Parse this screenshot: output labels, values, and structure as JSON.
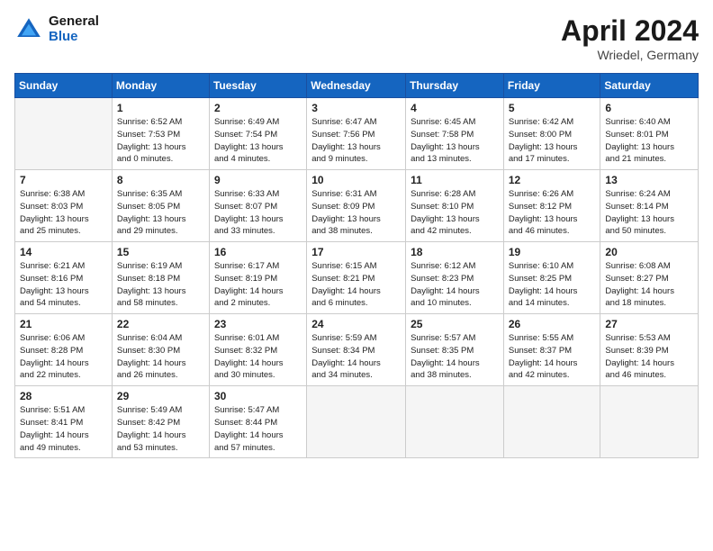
{
  "header": {
    "logo_general": "General",
    "logo_blue": "Blue",
    "title": "April 2024",
    "location": "Wriedel, Germany"
  },
  "days_of_week": [
    "Sunday",
    "Monday",
    "Tuesday",
    "Wednesday",
    "Thursday",
    "Friday",
    "Saturday"
  ],
  "weeks": [
    [
      {
        "day": "",
        "info": ""
      },
      {
        "day": "1",
        "info": "Sunrise: 6:52 AM\nSunset: 7:53 PM\nDaylight: 13 hours\nand 0 minutes."
      },
      {
        "day": "2",
        "info": "Sunrise: 6:49 AM\nSunset: 7:54 PM\nDaylight: 13 hours\nand 4 minutes."
      },
      {
        "day": "3",
        "info": "Sunrise: 6:47 AM\nSunset: 7:56 PM\nDaylight: 13 hours\nand 9 minutes."
      },
      {
        "day": "4",
        "info": "Sunrise: 6:45 AM\nSunset: 7:58 PM\nDaylight: 13 hours\nand 13 minutes."
      },
      {
        "day": "5",
        "info": "Sunrise: 6:42 AM\nSunset: 8:00 PM\nDaylight: 13 hours\nand 17 minutes."
      },
      {
        "day": "6",
        "info": "Sunrise: 6:40 AM\nSunset: 8:01 PM\nDaylight: 13 hours\nand 21 minutes."
      }
    ],
    [
      {
        "day": "7",
        "info": "Sunrise: 6:38 AM\nSunset: 8:03 PM\nDaylight: 13 hours\nand 25 minutes."
      },
      {
        "day": "8",
        "info": "Sunrise: 6:35 AM\nSunset: 8:05 PM\nDaylight: 13 hours\nand 29 minutes."
      },
      {
        "day": "9",
        "info": "Sunrise: 6:33 AM\nSunset: 8:07 PM\nDaylight: 13 hours\nand 33 minutes."
      },
      {
        "day": "10",
        "info": "Sunrise: 6:31 AM\nSunset: 8:09 PM\nDaylight: 13 hours\nand 38 minutes."
      },
      {
        "day": "11",
        "info": "Sunrise: 6:28 AM\nSunset: 8:10 PM\nDaylight: 13 hours\nand 42 minutes."
      },
      {
        "day": "12",
        "info": "Sunrise: 6:26 AM\nSunset: 8:12 PM\nDaylight: 13 hours\nand 46 minutes."
      },
      {
        "day": "13",
        "info": "Sunrise: 6:24 AM\nSunset: 8:14 PM\nDaylight: 13 hours\nand 50 minutes."
      }
    ],
    [
      {
        "day": "14",
        "info": "Sunrise: 6:21 AM\nSunset: 8:16 PM\nDaylight: 13 hours\nand 54 minutes."
      },
      {
        "day": "15",
        "info": "Sunrise: 6:19 AM\nSunset: 8:18 PM\nDaylight: 13 hours\nand 58 minutes."
      },
      {
        "day": "16",
        "info": "Sunrise: 6:17 AM\nSunset: 8:19 PM\nDaylight: 14 hours\nand 2 minutes."
      },
      {
        "day": "17",
        "info": "Sunrise: 6:15 AM\nSunset: 8:21 PM\nDaylight: 14 hours\nand 6 minutes."
      },
      {
        "day": "18",
        "info": "Sunrise: 6:12 AM\nSunset: 8:23 PM\nDaylight: 14 hours\nand 10 minutes."
      },
      {
        "day": "19",
        "info": "Sunrise: 6:10 AM\nSunset: 8:25 PM\nDaylight: 14 hours\nand 14 minutes."
      },
      {
        "day": "20",
        "info": "Sunrise: 6:08 AM\nSunset: 8:27 PM\nDaylight: 14 hours\nand 18 minutes."
      }
    ],
    [
      {
        "day": "21",
        "info": "Sunrise: 6:06 AM\nSunset: 8:28 PM\nDaylight: 14 hours\nand 22 minutes."
      },
      {
        "day": "22",
        "info": "Sunrise: 6:04 AM\nSunset: 8:30 PM\nDaylight: 14 hours\nand 26 minutes."
      },
      {
        "day": "23",
        "info": "Sunrise: 6:01 AM\nSunset: 8:32 PM\nDaylight: 14 hours\nand 30 minutes."
      },
      {
        "day": "24",
        "info": "Sunrise: 5:59 AM\nSunset: 8:34 PM\nDaylight: 14 hours\nand 34 minutes."
      },
      {
        "day": "25",
        "info": "Sunrise: 5:57 AM\nSunset: 8:35 PM\nDaylight: 14 hours\nand 38 minutes."
      },
      {
        "day": "26",
        "info": "Sunrise: 5:55 AM\nSunset: 8:37 PM\nDaylight: 14 hours\nand 42 minutes."
      },
      {
        "day": "27",
        "info": "Sunrise: 5:53 AM\nSunset: 8:39 PM\nDaylight: 14 hours\nand 46 minutes."
      }
    ],
    [
      {
        "day": "28",
        "info": "Sunrise: 5:51 AM\nSunset: 8:41 PM\nDaylight: 14 hours\nand 49 minutes."
      },
      {
        "day": "29",
        "info": "Sunrise: 5:49 AM\nSunset: 8:42 PM\nDaylight: 14 hours\nand 53 minutes."
      },
      {
        "day": "30",
        "info": "Sunrise: 5:47 AM\nSunset: 8:44 PM\nDaylight: 14 hours\nand 57 minutes."
      },
      {
        "day": "",
        "info": ""
      },
      {
        "day": "",
        "info": ""
      },
      {
        "day": "",
        "info": ""
      },
      {
        "day": "",
        "info": ""
      }
    ]
  ]
}
